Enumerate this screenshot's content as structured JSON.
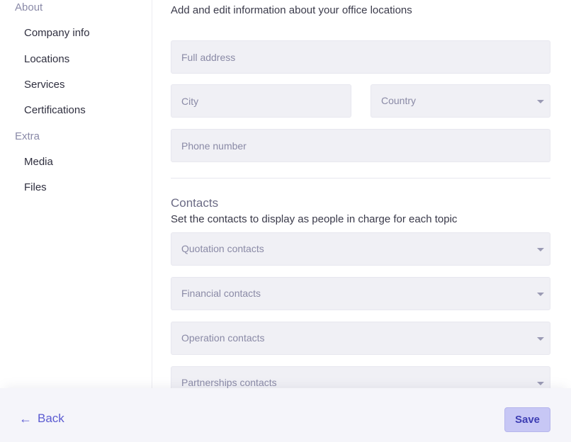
{
  "sidebar": {
    "sections": [
      {
        "label": "About",
        "items": [
          {
            "label": "Company info"
          },
          {
            "label": "Locations"
          },
          {
            "label": "Services"
          },
          {
            "label": "Certifications"
          }
        ]
      },
      {
        "label": "Extra",
        "items": [
          {
            "label": "Media"
          },
          {
            "label": "Files"
          }
        ]
      }
    ]
  },
  "locations": {
    "intro": "Add and edit information about your office locations",
    "full_address_placeholder": "Full address",
    "city_placeholder": "City",
    "country_placeholder": "Country",
    "phone_placeholder": "Phone number"
  },
  "contacts": {
    "title": "Contacts",
    "subtitle": "Set the contacts to display as people in charge for each topic",
    "quotation_placeholder": "Quotation contacts",
    "financial_placeholder": "Financial contacts",
    "operation_placeholder": "Operation contacts",
    "partnerships_placeholder": "Partnerships contacts"
  },
  "footer": {
    "back_label": "Back",
    "save_label": "Save"
  },
  "colors": {
    "accent": "#5c5cd1",
    "save_bg": "#c7c7f5",
    "field_bg": "#f0f0f5"
  },
  "icons": {
    "back": "arrow-left-icon",
    "dropdown": "chevron-down-icon"
  }
}
